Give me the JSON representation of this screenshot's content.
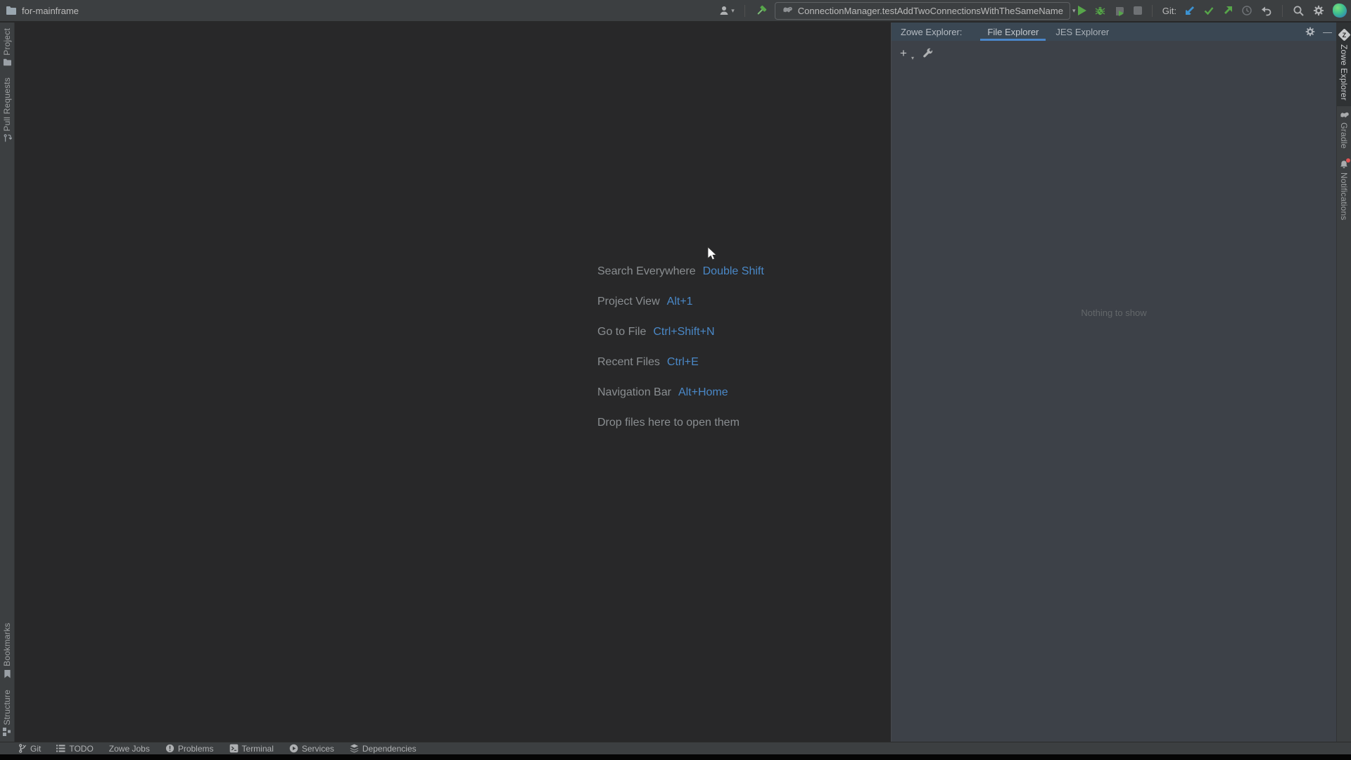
{
  "window": {
    "project_name": "for-mainframe"
  },
  "toolbar": {
    "run_config": "ConnectionManager.testAddTwoConnectionsWithTheSameName",
    "git_label": "Git:"
  },
  "left_stripe": {
    "top": [
      {
        "label": "Project"
      },
      {
        "label": "Pull Requests"
      }
    ],
    "bottom": [
      {
        "label": "Bookmarks"
      },
      {
        "label": "Structure"
      }
    ]
  },
  "editor": {
    "shortcuts": [
      {
        "label": "Search Everywhere",
        "keys": "Double Shift"
      },
      {
        "label": "Project View",
        "keys": "Alt+1"
      },
      {
        "label": "Go to File",
        "keys": "Ctrl+Shift+N"
      },
      {
        "label": "Recent Files",
        "keys": "Ctrl+E"
      },
      {
        "label": "Navigation Bar",
        "keys": "Alt+Home"
      }
    ],
    "drop_hint": "Drop files here to open them"
  },
  "tool_window": {
    "title": "Zowe Explorer:",
    "tabs": [
      {
        "label": "File Explorer",
        "active": true
      },
      {
        "label": "JES Explorer",
        "active": false
      }
    ],
    "empty_text": "Nothing to show",
    "add_glyph": "+",
    "minimize_glyph": "—"
  },
  "right_stripe": {
    "items": [
      {
        "label": "Zowe Explorer",
        "active": true
      },
      {
        "label": "Gradle",
        "active": false
      },
      {
        "label": "Notifications",
        "active": false
      }
    ],
    "zowe_glyph": "Z"
  },
  "statusbar": {
    "items": [
      {
        "label": "Git"
      },
      {
        "label": "TODO"
      },
      {
        "label": "Zowe Jobs"
      },
      {
        "label": "Problems"
      },
      {
        "label": "Terminal"
      },
      {
        "label": "Services"
      },
      {
        "label": "Dependencies"
      }
    ]
  },
  "icons": {
    "chevron_down": "▾"
  },
  "colors": {
    "panel_bg": "#3C3F41",
    "editor_bg": "#282829",
    "tool_window_bg": "#3D4148",
    "header_bg": "#3A4753",
    "accent_blue": "#4A88C7",
    "tab_underline": "#4A86C9",
    "green": "#57A64A",
    "git_blue": "#3C92D1",
    "text_light": "#BBBBBB",
    "text_dim": "#8A8E91",
    "empty_text": "#63676A",
    "red_badge": "#E05555"
  }
}
